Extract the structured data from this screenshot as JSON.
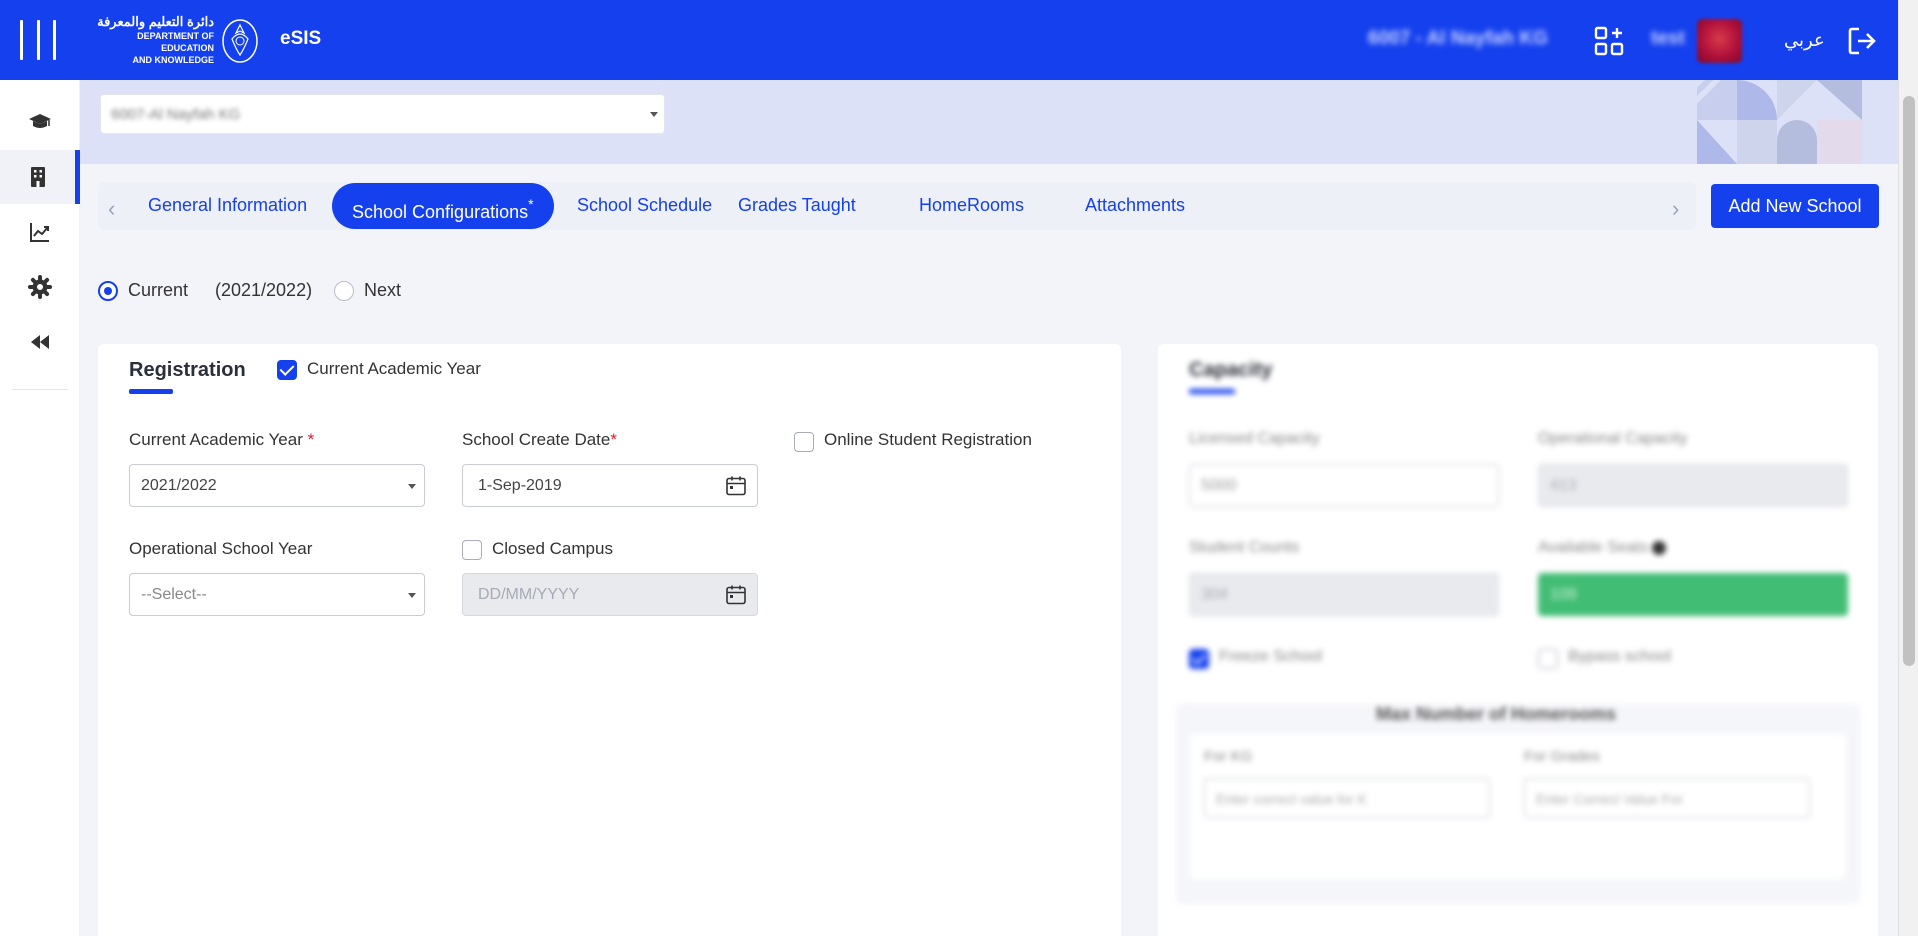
{
  "header": {
    "logo_arabic": "دائرة التعليم والمعرفة",
    "logo_line1": "DEPARTMENT OF EDUCATION",
    "logo_line2": "AND KNOWLEDGE",
    "brand": "eSIS",
    "school": "6007 - Al Nayfah KG",
    "user": "test",
    "language": "عربي",
    "accent_color": "#1540ee"
  },
  "sidebar": {
    "items": [
      {
        "icon": "graduation-cap-icon"
      },
      {
        "icon": "building-icon",
        "active": true
      },
      {
        "icon": "chart-line-icon"
      },
      {
        "icon": "gear-icon"
      },
      {
        "icon": "collapse-icon"
      }
    ]
  },
  "school_selector": {
    "value": "6007-Al Nayfah KG"
  },
  "tabs": [
    {
      "label": "General Information"
    },
    {
      "label": "School Configurations",
      "marker": "*",
      "active": true
    },
    {
      "label": "School Schedule"
    },
    {
      "label": "Grades Taught"
    },
    {
      "label": "HomeRooms"
    },
    {
      "label": "Attachments"
    }
  ],
  "add_school_label": "Add New School",
  "year_selection": {
    "current_label": "Current",
    "current_year": "(2021/2022)",
    "next_label": "Next",
    "selected": "current"
  },
  "registration": {
    "title": "Registration",
    "current_year_checkbox": "Current Academic Year",
    "academic_year_label": "Current Academic Year",
    "academic_year_value": "2021/2022",
    "create_date_label": "School Create Date",
    "create_date_value": "1-Sep-2019",
    "online_registration_label": "Online Student Registration",
    "operational_year_label": "Operational School Year",
    "operational_year_value": "--Select--",
    "closed_campus_label": "Closed Campus",
    "closed_campus_date_placeholder": "DD/MM/YYYY",
    "required_marker": "*"
  },
  "capacity": {
    "title": "Capacity",
    "licensed_label": "Licensed Capacity",
    "licensed_value": "5000",
    "operational_label": "Operational Capacity",
    "operational_value": "413",
    "student_counts_label": "Student Counts",
    "student_counts_value": "304",
    "available_seats_label": "Available Seats",
    "available_seats_value": "109",
    "freeze_label": "Freeze School",
    "bypass_label": "Bypass school",
    "homerooms_title": "Max Number of Homerooms",
    "for_kg_label": "For KG",
    "for_kg_placeholder": "Enter correct value for K",
    "for_grades_label": "For Grades",
    "for_grades_placeholder": "Enter Correct Value For",
    "seats_color": "#42bd74"
  }
}
